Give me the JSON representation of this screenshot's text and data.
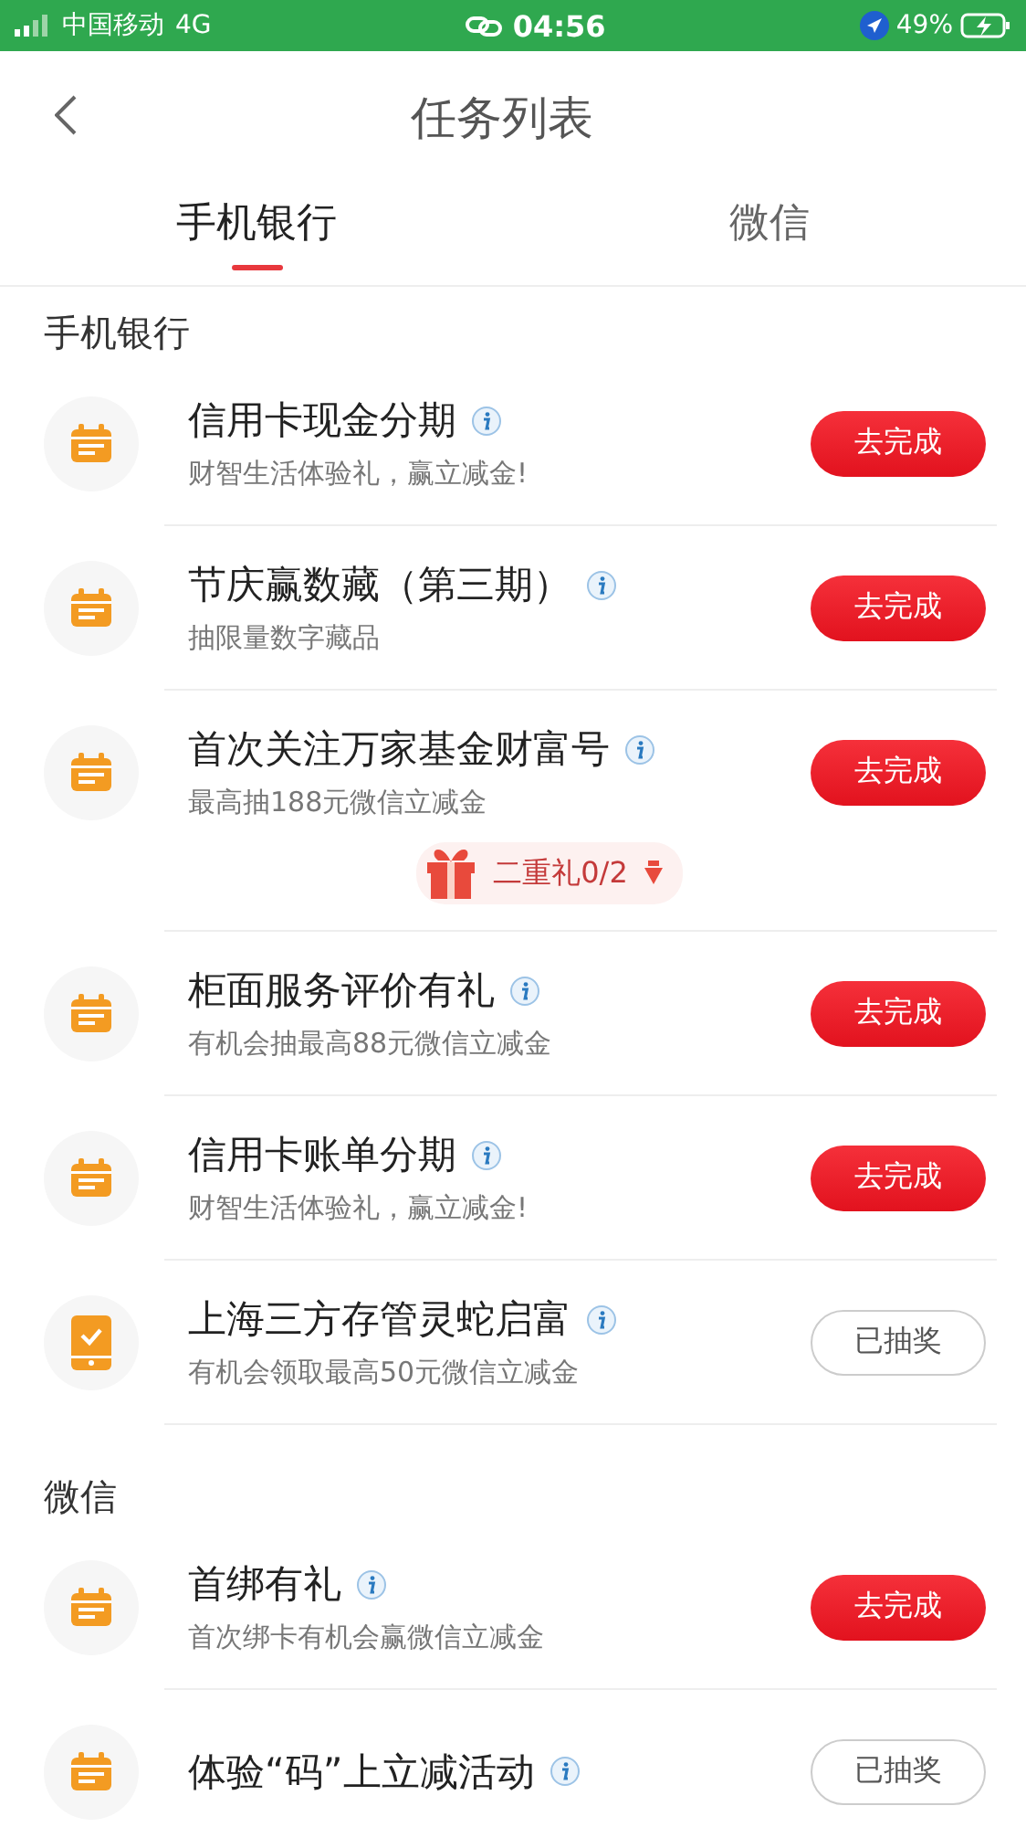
{
  "status_bar": {
    "carrier": "中国移动",
    "network": "4G",
    "time": "04:56",
    "battery": "49%"
  },
  "header": {
    "title": "任务列表"
  },
  "tabs": [
    {
      "label": "手机银行",
      "selected": true
    },
    {
      "label": "微信",
      "selected": false
    }
  ],
  "sections": [
    {
      "title": "手机银行",
      "tasks": [
        {
          "kind": "calendar",
          "title": "信用卡现金分期",
          "subtitle": "财智生活体验礼，赢立减金!",
          "action": "去完成",
          "done": false
        },
        {
          "kind": "calendar",
          "title": "节庆赢数藏（第三期）",
          "subtitle": "抽限量数字藏品",
          "action": "去完成",
          "done": false
        },
        {
          "kind": "calendar",
          "title": "首次关注万家基金财富号",
          "subtitle": "最高抽188元微信立减金",
          "action": "去完成",
          "done": false,
          "bonus": "二重礼0/2"
        },
        {
          "kind": "calendar",
          "title": "柜面服务评价有礼",
          "subtitle": "有机会抽最高88元微信立减金",
          "action": "去完成",
          "done": false
        },
        {
          "kind": "calendar",
          "title": "信用卡账单分期",
          "subtitle": "财智生活体验礼，赢立减金!",
          "action": "去完成",
          "done": false
        },
        {
          "kind": "phone",
          "title": "上海三方存管灵蛇启富",
          "subtitle": "有机会领取最高50元微信立减金",
          "action": "已抽奖",
          "done": true
        }
      ]
    },
    {
      "title": "微信",
      "tasks": [
        {
          "kind": "calendar",
          "title": "首绑有礼",
          "subtitle": "首次绑卡有机会赢微信立减金",
          "action": "去完成",
          "done": false
        },
        {
          "kind": "calendar",
          "title": "体验“码”上立减活动",
          "action": "已抽奖",
          "done": true
        }
      ]
    }
  ]
}
